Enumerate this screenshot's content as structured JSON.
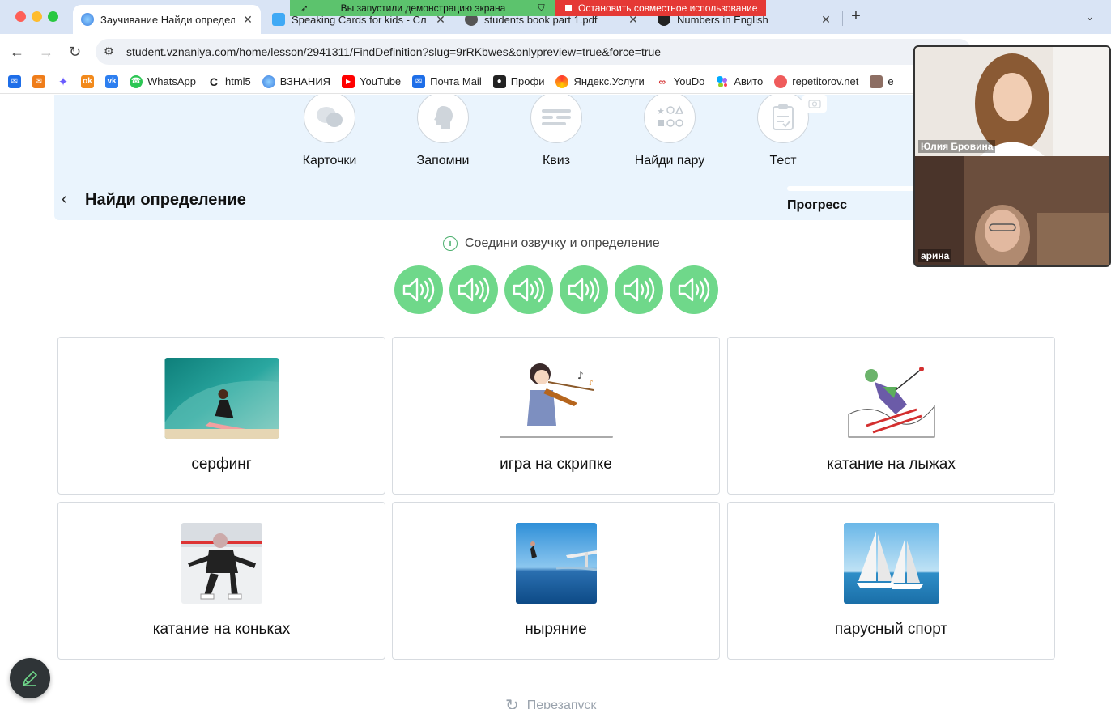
{
  "browser": {
    "tabs": [
      {
        "title": "Заучивание Найди определе",
        "active": true
      },
      {
        "title": "Speaking Cards for kids - Сл",
        "active": false
      },
      {
        "title": "students book part 1.pdf",
        "active": false
      },
      {
        "title": "Numbers in English",
        "active": false
      }
    ],
    "screen_share": {
      "notice": "Вы запустили демонстрацию экрана",
      "stop_label": "Остановить совместное использование"
    },
    "url": "student.vznaniya.com/home/lesson/2941311/FindDefinition?slug=9rRKbwes&onlypreview=true&force=true",
    "bookmarks": [
      "WhatsApp",
      "html5",
      "ВЗНАНИЯ",
      "YouTube",
      "Почта Mail",
      "Профи",
      "Яндекс.Услуги",
      "YouDo",
      "Авито",
      "repetitorov.net",
      "e"
    ]
  },
  "modes": [
    "Карточки",
    "Запомни",
    "Квиз",
    "Найди пару",
    "Тест"
  ],
  "page": {
    "title": "Найди определение",
    "progress_label": "Прогресс",
    "instruction": "Соедини озвучку и определение",
    "audio_count": 6,
    "restart_label": "Перезапуск"
  },
  "cards": [
    {
      "label": "серфинг",
      "icon": "surfing-image"
    },
    {
      "label": "игра на скрипке",
      "icon": "violin-image"
    },
    {
      "label": "катание на лыжах",
      "icon": "skiing-image"
    },
    {
      "label": "катание на коньках",
      "icon": "skating-image"
    },
    {
      "label": "ныряние",
      "icon": "diving-image"
    },
    {
      "label": "парусный спорт",
      "icon": "sailing-image"
    }
  ],
  "video": {
    "participants": [
      "Юлия Бровина",
      "арина"
    ]
  },
  "colors": {
    "accent_green": "#6fd88a",
    "banner_bg": "#eaf4fd",
    "share_green": "#5cc36d",
    "share_red": "#e53935"
  }
}
